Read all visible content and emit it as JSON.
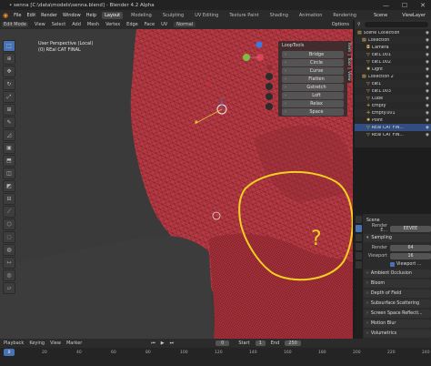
{
  "window": {
    "title": "• senna [C:\\data\\models\\senna.blend] - Blender 4.2 Alpha",
    "controls": [
      "—",
      "☐",
      "✕"
    ]
  },
  "menubar": {
    "items": [
      "File",
      "Edit",
      "Render",
      "Window",
      "Help"
    ],
    "tabs": [
      "Layout",
      "Modeling",
      "Sculpting",
      "UV Editing",
      "Texture Paint",
      "Shading",
      "Animation",
      "Rendering"
    ],
    "active_tab": "Layout",
    "scene_label": "Scene",
    "viewlayer_label": "ViewLayer"
  },
  "viewport_header": {
    "mode": "Edit Mode",
    "items": [
      "View",
      "Select",
      "Add",
      "Mesh",
      "Vertex",
      "Edge",
      "Face",
      "UV"
    ],
    "transform": "Normal",
    "options_label": "Options"
  },
  "viewport_info": {
    "line1": "User Perspective (Local)",
    "line2": "(0) REal CAT FINAL"
  },
  "looptools": {
    "header": "LoopTools",
    "buttons": [
      "Bridge",
      "Circle",
      "Curve",
      "Flatten",
      "Gstretch",
      "Loft",
      "Relax",
      "Space"
    ]
  },
  "sidebar_tabs": [
    "Item",
    "Tool",
    "View"
  ],
  "outliner": {
    "search_placeholder": "",
    "rows": [
      {
        "name": "Scene Collection",
        "indent": 0,
        "icon": "collection-icon",
        "selected": false
      },
      {
        "name": "Collection",
        "indent": 1,
        "icon": "collection-icon",
        "selected": false
      },
      {
        "name": "Camera",
        "indent": 2,
        "icon": "camera-icon",
        "selected": false
      },
      {
        "name": "cat1.001",
        "indent": 2,
        "icon": "mesh-icon",
        "selected": false
      },
      {
        "name": "cat1.002",
        "indent": 2,
        "icon": "mesh-icon",
        "selected": false
      },
      {
        "name": "Light",
        "indent": 2,
        "icon": "light-icon",
        "selected": false
      },
      {
        "name": "Collection 2",
        "indent": 1,
        "icon": "collection-icon",
        "selected": false
      },
      {
        "name": "cat1",
        "indent": 2,
        "icon": "mesh-icon",
        "selected": false
      },
      {
        "name": "cat1.003",
        "indent": 2,
        "icon": "mesh-icon",
        "selected": false
      },
      {
        "name": "Cube",
        "indent": 2,
        "icon": "mesh-icon",
        "selected": false
      },
      {
        "name": "Empty",
        "indent": 2,
        "icon": "empty-icon",
        "selected": false
      },
      {
        "name": "Empty.001",
        "indent": 2,
        "icon": "empty-icon",
        "selected": false
      },
      {
        "name": "Point",
        "indent": 2,
        "icon": "light-icon",
        "selected": false
      },
      {
        "name": "REal CAT FIN...",
        "indent": 2,
        "icon": "mesh-icon",
        "selected": true
      },
      {
        "name": "REal CAT FIN...",
        "indent": 2,
        "icon": "mesh-icon",
        "selected": false
      }
    ]
  },
  "properties": {
    "scene_name": "Scene",
    "render_engine_label": "Render E...",
    "render_engine_value": "EEVEE",
    "sections": [
      "Sampling",
      "Ambient Occlusion",
      "Bloom",
      "Depth of Field",
      "Subsurface Scattering",
      "Screen Space Reflecti...",
      "Motion Blur",
      "Volumetrics"
    ],
    "render_label": "Render",
    "render_value": "64",
    "viewport_label": "Viewport",
    "viewport_value": "16",
    "viewport_denoise_label": "Viewport ..."
  },
  "timeline": {
    "menu": [
      "Playback",
      "Keying",
      "View",
      "Marker"
    ],
    "current_frame": "0",
    "start_label": "Start",
    "start_value": "1",
    "end_label": "End",
    "end_value": "250",
    "ticks": [
      "0",
      "20",
      "40",
      "60",
      "80",
      "100",
      "120",
      "140",
      "160",
      "180",
      "200",
      "220",
      "240"
    ]
  },
  "annotation": {
    "text": "?",
    "color": "#f5d020"
  },
  "colors": {
    "mesh": "#c0404a",
    "accent": "#4772b3"
  }
}
